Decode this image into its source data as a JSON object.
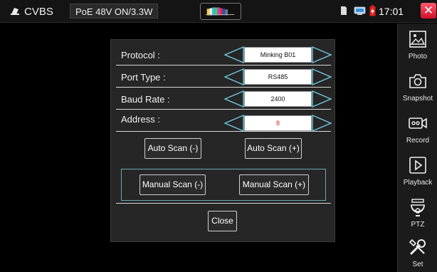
{
  "statusbar": {
    "mode": "CVBS",
    "poe": "PoE 48V ON/3.3W",
    "time": "17:01",
    "icons": [
      "camera-icon",
      "signal-test-icon",
      "sd-card-icon",
      "network-icon",
      "battery-charging-icon",
      "close-icon"
    ],
    "close_color": "#e0142e"
  },
  "sidebar": {
    "items": [
      {
        "label": "Photo",
        "icon": "photo-icon"
      },
      {
        "label": "Snapshot",
        "icon": "snapshot-camera-icon"
      },
      {
        "label": "Record",
        "icon": "record-video-icon"
      },
      {
        "label": "Playback",
        "icon": "playback-icon"
      },
      {
        "label": "PTZ",
        "icon": "ptz-dome-camera-icon"
      },
      {
        "label": "Set",
        "icon": "settings-tools-icon"
      }
    ]
  },
  "dialog": {
    "fields": [
      {
        "label": "Protocol :",
        "value": "Minking B01"
      },
      {
        "label": "Port Type :",
        "value": "RS485"
      },
      {
        "label": "Baud Rate :",
        "value": "2400"
      },
      {
        "label": "Address :",
        "value": "8"
      }
    ],
    "buttons": {
      "auto_scan_minus": "Auto Scan (-)",
      "auto_scan_plus": "Auto Scan (+)",
      "manual_scan_minus": "Manual Scan (-)",
      "manual_scan_plus": "Manual Scan (+)",
      "close": "Close"
    }
  },
  "colors": {
    "background": "#000000",
    "dialog": "#262626",
    "accent_frame": "#6fa7b8",
    "address_value": "#e02020"
  }
}
